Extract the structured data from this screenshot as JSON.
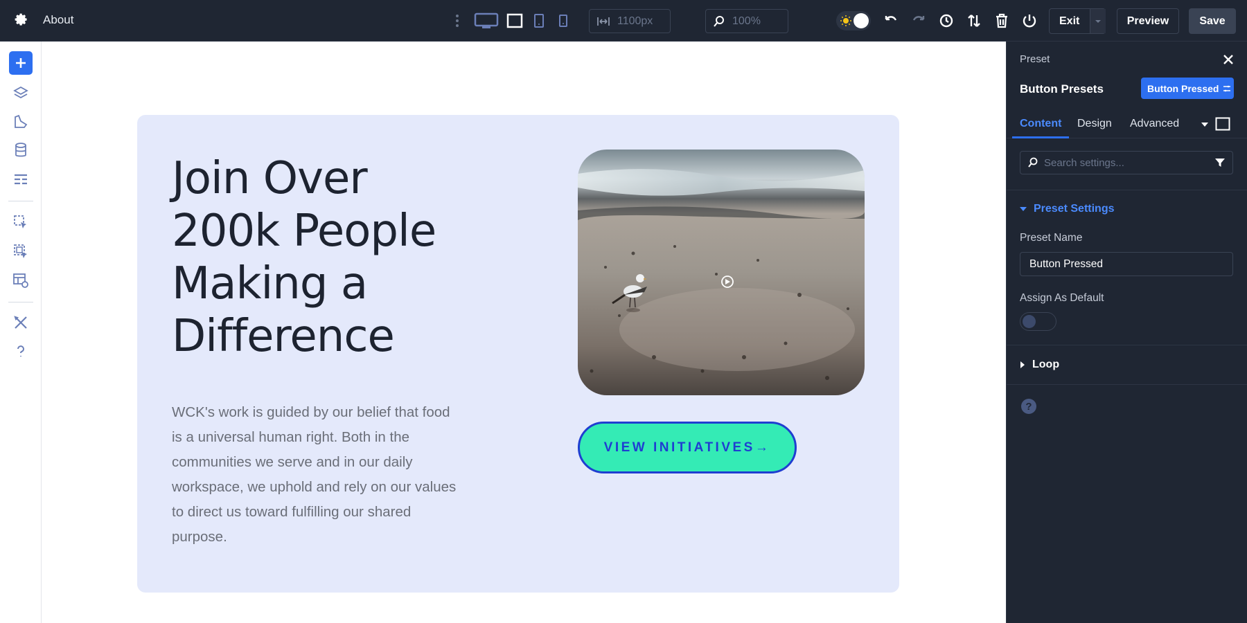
{
  "topbar": {
    "title": "About",
    "width_value": "1100px",
    "zoom_value": "100%",
    "exit_label": "Exit",
    "preview_label": "Preview",
    "save_label": "Save"
  },
  "canvas": {
    "heading": "Join Over 200k People Making a Difference",
    "body": "WCK's work is guided by our belief that food is a universal human right. Both in the communities we serve and in our daily workspace, we uphold and rely on our values to direct us toward fulfilling our shared purpose.",
    "cta_label": "VIEW INITIATIVES→",
    "cta_bg": "#34ebb5",
    "cta_text": "#1f3ed1",
    "section_bg": "#e4e9fb"
  },
  "panel": {
    "preset_label": "Preset",
    "title": "Button Presets",
    "badge": "Button Pressed",
    "tabs": [
      "Content",
      "Design",
      "Advanced"
    ],
    "search_placeholder": "Search settings...",
    "group_preset_settings": "Preset Settings",
    "preset_name_label": "Preset Name",
    "preset_name_value": "Button Pressed",
    "assign_default_label": "Assign As Default",
    "assign_default_on": false,
    "group_loop": "Loop"
  },
  "colors": {
    "accent": "#2d6ff0",
    "panel_bg": "#1f2633"
  },
  "icons": [
    "gear-icon",
    "kebab-icon",
    "desktop-icon",
    "laptop-icon",
    "tablet-icon",
    "phone-icon",
    "width-icon",
    "search-icon",
    "sun-icon",
    "undo-icon",
    "redo-icon",
    "history-icon",
    "sort-icon",
    "trash-icon",
    "power-icon",
    "plus-icon",
    "layers-icon",
    "design-icon",
    "database-icon",
    "layout-icon",
    "select-icon",
    "multi-select-icon",
    "theme-builder-icon",
    "tools-icon",
    "help-icon",
    "close-icon",
    "filter-icon",
    "caret-icon",
    "play-icon"
  ]
}
